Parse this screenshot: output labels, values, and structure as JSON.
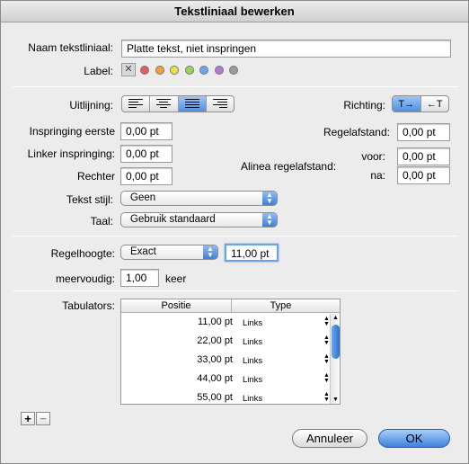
{
  "window": {
    "title": "Tekstliniaal bewerken"
  },
  "name": {
    "label": "Naam tekstliniaal:",
    "value": "Platte tekst, niet inspringen"
  },
  "label": {
    "label": "Label:",
    "colors": [
      "#e85a5a",
      "#f0a040",
      "#ede04a",
      "#9bd25a",
      "#6aa6f0",
      "#b07ad8",
      "#9a9a9a"
    ]
  },
  "alignment": {
    "label": "Uitlijning:",
    "options": [
      "left-align-icon",
      "center-align-icon",
      "justify-align-icon",
      "right-align-icon"
    ],
    "selected": 2
  },
  "direction": {
    "label": "Richting:",
    "ltr": "T→",
    "rtl": "←T",
    "selected": 0
  },
  "indent": {
    "first_label": "Inspringing eerste",
    "first_value": "0,00 pt",
    "left_label": "Linker inspringing:",
    "left_value": "0,00 pt",
    "right_label": "Rechter",
    "right_value": "0,00 pt"
  },
  "spacing": {
    "line_label": "Regelafstand:",
    "line_value": "0,00 pt",
    "para_label": "Alinea regelafstand:",
    "before_label": "voor:",
    "before_value": "0,00 pt",
    "after_label": "na:",
    "after_value": "0,00 pt"
  },
  "text_style": {
    "label": "Tekst stijl:",
    "value": "Geen"
  },
  "language": {
    "label": "Taal:",
    "value": "Gebruik standaard"
  },
  "line_height": {
    "label": "Regelhoogte:",
    "mode": "Exact",
    "value": "11,00 pt"
  },
  "multiple": {
    "label": "meervoudig:",
    "value": "1,00",
    "unit": "keer"
  },
  "tabs": {
    "label": "Tabulators:",
    "col_position": "Positie",
    "col_type": "Type",
    "rows": [
      {
        "position": "11,00 pt",
        "type": "Links"
      },
      {
        "position": "22,00 pt",
        "type": "Links"
      },
      {
        "position": "33,00 pt",
        "type": "Links"
      },
      {
        "position": "44,00 pt",
        "type": "Links"
      },
      {
        "position": "55,00 pt",
        "type": "Links"
      }
    ],
    "add": "+",
    "remove": "−"
  },
  "buttons": {
    "cancel": "Annuleer",
    "ok": "OK"
  }
}
